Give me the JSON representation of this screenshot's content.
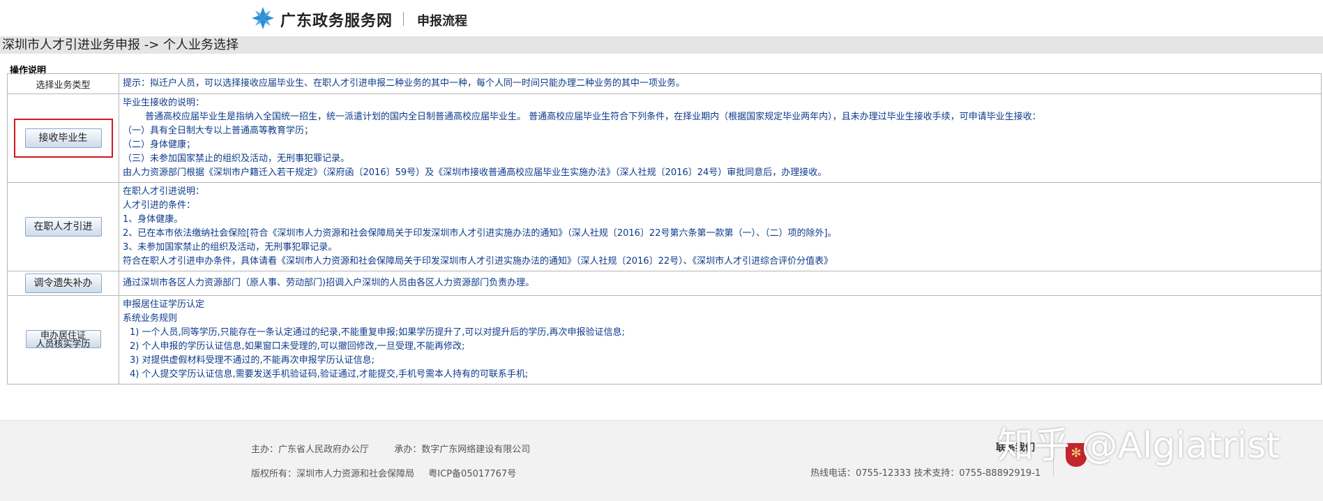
{
  "header": {
    "site_name": "广东政务服务网",
    "page_name": "申报流程"
  },
  "breadcrumb": "深圳市人才引进业务申报 -> 个人业务选择",
  "section_title": "操作说明",
  "table": {
    "header_left": "选择业务类型",
    "header_right": "提示：拟迁户人员，可以选择接收应届毕业生、在职人才引进申报二种业务的其中一种，每个人同一时间只能办理二种业务的其中一项业务。",
    "rows": [
      {
        "button": "接收毕业生",
        "lines": [
          "毕业生接收的说明：",
          "普通高校应届毕业生是指纳入全国统一招生，统一派遣计划的国内全日制普通高校应届毕业生。 普通高校应届毕业生符合下列条件，在择业期内（根据国家规定毕业两年内），且未办理过毕业生接收手续，可申请毕业生接收：",
          "（一）具有全日制大专以上普通高等教育学历；",
          "（二）身体健康；",
          "（三）未参加国家禁止的组织及活动，无刑事犯罪记录。",
          "由人力资源部门根据《深圳市户籍迁入若干规定》（深府函〔2016〕59号）及《深圳市接收普通高校应届毕业生实施办法》（深人社规〔2016〕24号）审批同意后，办理接收。"
        ]
      },
      {
        "button": "在职人才引进",
        "lines": [
          "在职人才引进说明：",
          "人才引进的条件：",
          "1、身体健康。",
          "2、已在本市依法缴纳社会保险[符合《深圳市人力资源和社会保障局关于印发深圳市人才引进实施办法的通知》（深人社规〔2016〕22号第六条第一款第（一）、（二）项的除外]。",
          "3、未参加国家禁止的组织及活动，无刑事犯罪记录。",
          "符合在职人才引进申办条件，具体请看《深圳市人力资源和社会保障局关于印发深圳市人才引进实施办法的通知》（深人社规〔2016〕22号）、《深圳市人才引进综合评价分值表》"
        ]
      },
      {
        "button": "调令遗失补办",
        "lines": [
          "通过深圳市各区人力资源部门（原人事、劳动部门)招调入户深圳的人员由各区人力资源部门负责办理。"
        ]
      },
      {
        "button_line1": "申办居住证",
        "button_line2": "人员核实学历",
        "lines": [
          "申报居住证学历认定",
          "系统业务规则",
          "1) 一个人员,同等学历,只能存在一条认定通过的纪录,不能重复申报;如果学历提升了,可以对提升后的学历,再次申报验证信息;",
          "2) 个人申报的学历认证信息,如果窗口未受理的,可以撤回修改,一旦受理,不能再修改;",
          "3) 对提供虚假材料受理不通过的,不能再次申报学历认证信息;",
          "4) 个人提交学历认证信息,需要发送手机验证码,验证通过,才能提交,手机号需本人持有的可联系手机;"
        ]
      }
    ]
  },
  "footer": {
    "sponsor": "主办：广东省人民政府办公厅",
    "operator": "承办：数字广东网络建设有限公司",
    "copyright": "版权所有：深圳市人力资源和社会保障局",
    "icp": "粤ICP备05017767号",
    "contact_label": "联系我们",
    "hotline": "热线电话：0755-12333 技术支持：0755-88892919-1"
  },
  "watermark": "知乎 @Algiatrist",
  "colors": {
    "highlight_border": "#d0191d",
    "link_text": "#0c3a8a",
    "logo_blue": "#2b8fd6"
  }
}
